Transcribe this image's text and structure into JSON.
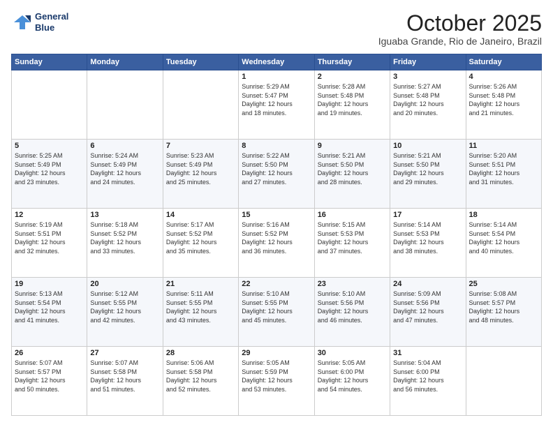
{
  "header": {
    "logo_line1": "General",
    "logo_line2": "Blue",
    "month_title": "October 2025",
    "location": "Iguaba Grande, Rio de Janeiro, Brazil"
  },
  "days_of_week": [
    "Sunday",
    "Monday",
    "Tuesday",
    "Wednesday",
    "Thursday",
    "Friday",
    "Saturday"
  ],
  "weeks": [
    [
      {
        "day": "",
        "info": ""
      },
      {
        "day": "",
        "info": ""
      },
      {
        "day": "",
        "info": ""
      },
      {
        "day": "1",
        "info": "Sunrise: 5:29 AM\nSunset: 5:47 PM\nDaylight: 12 hours\nand 18 minutes."
      },
      {
        "day": "2",
        "info": "Sunrise: 5:28 AM\nSunset: 5:48 PM\nDaylight: 12 hours\nand 19 minutes."
      },
      {
        "day": "3",
        "info": "Sunrise: 5:27 AM\nSunset: 5:48 PM\nDaylight: 12 hours\nand 20 minutes."
      },
      {
        "day": "4",
        "info": "Sunrise: 5:26 AM\nSunset: 5:48 PM\nDaylight: 12 hours\nand 21 minutes."
      }
    ],
    [
      {
        "day": "5",
        "info": "Sunrise: 5:25 AM\nSunset: 5:49 PM\nDaylight: 12 hours\nand 23 minutes."
      },
      {
        "day": "6",
        "info": "Sunrise: 5:24 AM\nSunset: 5:49 PM\nDaylight: 12 hours\nand 24 minutes."
      },
      {
        "day": "7",
        "info": "Sunrise: 5:23 AM\nSunset: 5:49 PM\nDaylight: 12 hours\nand 25 minutes."
      },
      {
        "day": "8",
        "info": "Sunrise: 5:22 AM\nSunset: 5:50 PM\nDaylight: 12 hours\nand 27 minutes."
      },
      {
        "day": "9",
        "info": "Sunrise: 5:21 AM\nSunset: 5:50 PM\nDaylight: 12 hours\nand 28 minutes."
      },
      {
        "day": "10",
        "info": "Sunrise: 5:21 AM\nSunset: 5:50 PM\nDaylight: 12 hours\nand 29 minutes."
      },
      {
        "day": "11",
        "info": "Sunrise: 5:20 AM\nSunset: 5:51 PM\nDaylight: 12 hours\nand 31 minutes."
      }
    ],
    [
      {
        "day": "12",
        "info": "Sunrise: 5:19 AM\nSunset: 5:51 PM\nDaylight: 12 hours\nand 32 minutes."
      },
      {
        "day": "13",
        "info": "Sunrise: 5:18 AM\nSunset: 5:52 PM\nDaylight: 12 hours\nand 33 minutes."
      },
      {
        "day": "14",
        "info": "Sunrise: 5:17 AM\nSunset: 5:52 PM\nDaylight: 12 hours\nand 35 minutes."
      },
      {
        "day": "15",
        "info": "Sunrise: 5:16 AM\nSunset: 5:52 PM\nDaylight: 12 hours\nand 36 minutes."
      },
      {
        "day": "16",
        "info": "Sunrise: 5:15 AM\nSunset: 5:53 PM\nDaylight: 12 hours\nand 37 minutes."
      },
      {
        "day": "17",
        "info": "Sunrise: 5:14 AM\nSunset: 5:53 PM\nDaylight: 12 hours\nand 38 minutes."
      },
      {
        "day": "18",
        "info": "Sunrise: 5:14 AM\nSunset: 5:54 PM\nDaylight: 12 hours\nand 40 minutes."
      }
    ],
    [
      {
        "day": "19",
        "info": "Sunrise: 5:13 AM\nSunset: 5:54 PM\nDaylight: 12 hours\nand 41 minutes."
      },
      {
        "day": "20",
        "info": "Sunrise: 5:12 AM\nSunset: 5:55 PM\nDaylight: 12 hours\nand 42 minutes."
      },
      {
        "day": "21",
        "info": "Sunrise: 5:11 AM\nSunset: 5:55 PM\nDaylight: 12 hours\nand 43 minutes."
      },
      {
        "day": "22",
        "info": "Sunrise: 5:10 AM\nSunset: 5:55 PM\nDaylight: 12 hours\nand 45 minutes."
      },
      {
        "day": "23",
        "info": "Sunrise: 5:10 AM\nSunset: 5:56 PM\nDaylight: 12 hours\nand 46 minutes."
      },
      {
        "day": "24",
        "info": "Sunrise: 5:09 AM\nSunset: 5:56 PM\nDaylight: 12 hours\nand 47 minutes."
      },
      {
        "day": "25",
        "info": "Sunrise: 5:08 AM\nSunset: 5:57 PM\nDaylight: 12 hours\nand 48 minutes."
      }
    ],
    [
      {
        "day": "26",
        "info": "Sunrise: 5:07 AM\nSunset: 5:57 PM\nDaylight: 12 hours\nand 50 minutes."
      },
      {
        "day": "27",
        "info": "Sunrise: 5:07 AM\nSunset: 5:58 PM\nDaylight: 12 hours\nand 51 minutes."
      },
      {
        "day": "28",
        "info": "Sunrise: 5:06 AM\nSunset: 5:58 PM\nDaylight: 12 hours\nand 52 minutes."
      },
      {
        "day": "29",
        "info": "Sunrise: 5:05 AM\nSunset: 5:59 PM\nDaylight: 12 hours\nand 53 minutes."
      },
      {
        "day": "30",
        "info": "Sunrise: 5:05 AM\nSunset: 6:00 PM\nDaylight: 12 hours\nand 54 minutes."
      },
      {
        "day": "31",
        "info": "Sunrise: 5:04 AM\nSunset: 6:00 PM\nDaylight: 12 hours\nand 56 minutes."
      },
      {
        "day": "",
        "info": ""
      }
    ]
  ]
}
